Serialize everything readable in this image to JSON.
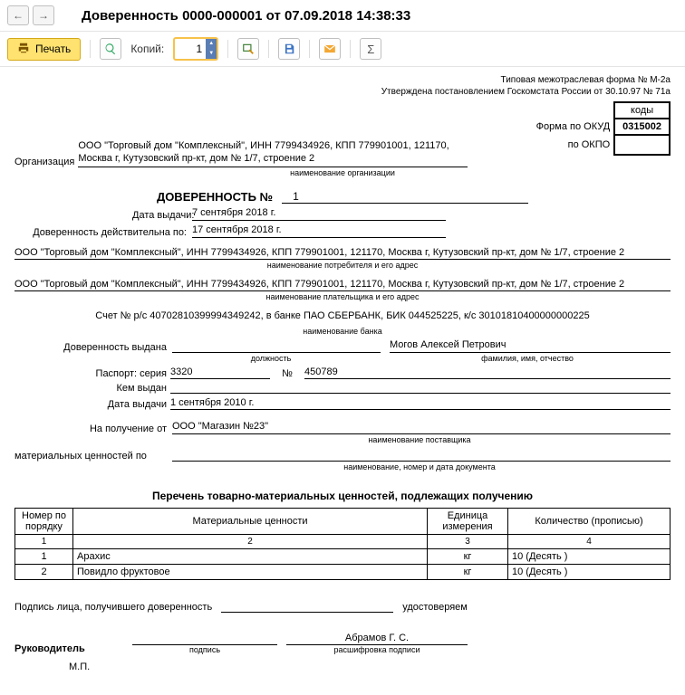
{
  "header": {
    "title": "Доверенность 0000-000001 от 07.09.2018 14:38:33"
  },
  "toolbar": {
    "print_label": "Печать",
    "copies_label": "Копий:",
    "copies_value": "1"
  },
  "doc": {
    "form_line1": "Типовая межотраслевая форма № М-2а",
    "form_line2": "Утверждена постановлением Госкомстата России от 30.10.97 № 71а",
    "codes_title": "коды",
    "okud_label": "Форма по ОКУД",
    "okud_value": "0315002",
    "okpo_label": "по ОКПО",
    "okpo_value": "",
    "org_label": "Организация",
    "org_value": "ООО \"Торговый дом \"Комплексный\", ИНН 7799434926, КПП 779901001, 121170, Москва г, Кутузовский пр-кт, дом № 1/7, строение 2",
    "org_caption": "наименование организации",
    "heading": "ДОВЕРЕННОСТЬ №",
    "number": "1",
    "issue_date_label": "Дата выдачи:",
    "issue_date": "7 сентября 2018 г.",
    "valid_label": "Доверенность действительна по:",
    "valid_date": "17 сентября 2018 г.",
    "consumer": "ООО \"Торговый дом \"Комплексный\", ИНН 7799434926, КПП 779901001, 121170, Москва г, Кутузовский пр-кт, дом № 1/7, строение 2",
    "consumer_caption": "наименование потребителя и его адрес",
    "payer": "ООО \"Торговый дом \"Комплексный\", ИНН 7799434926, КПП 779901001, 121170, Москва г, Кутузовский пр-кт, дом № 1/7, строение 2",
    "payer_caption": "наименование плательщика и его адрес",
    "account": "Счет №  р/с 40702810399994349242, в банке ПАО СБЕРБАНК, БИК 044525225, к/с 30101810400000000225",
    "account_caption": "наименование банка",
    "issued_to_label": "Доверенность выдана",
    "position_caption": "должность",
    "fio": "Могов Алексей Петрович",
    "fio_caption": "фамилия, имя, отчество",
    "passport_label": "Паспорт: серия",
    "passport_series": "3320",
    "passport_no_label": "№",
    "passport_number": "450789",
    "issued_by_label": "Кем выдан",
    "issued_by": "",
    "passport_date_label": "Дата выдачи",
    "passport_date": "1 сентября 2010 г.",
    "receive_from_label": "На получение от",
    "supplier": "ООО \"Магазин №23\"",
    "supplier_caption": "наименование поставщика",
    "values_label": "материальных ценностей по",
    "values_caption": "наименование, номер и дата документа",
    "table_title": "Перечень товарно-материальных ценностей, подлежащих получению",
    "columns": {
      "num": "Номер по порядку",
      "name": "Материальные ценности",
      "unit": "Единица измерения",
      "qty": "Количество (прописью)"
    },
    "subcols": {
      "c1": "1",
      "c2": "2",
      "c3": "3",
      "c4": "4"
    },
    "items": [
      {
        "n": "1",
        "name": "Арахис",
        "unit": "кг",
        "qty": "10 (Десять )"
      },
      {
        "n": "2",
        "name": "Повидло фруктовое",
        "unit": "кг",
        "qty": "10 (Десять )"
      }
    ],
    "sign_person_label": "Подпись лица, получившего доверенность",
    "certify_label": "удостоверяем",
    "director_label": "Руководитель",
    "sign_caption": "подпись",
    "director_name": "Абрамов Г. С.",
    "decode_caption": "расшифровка подписи",
    "mp_label": "М.П."
  }
}
